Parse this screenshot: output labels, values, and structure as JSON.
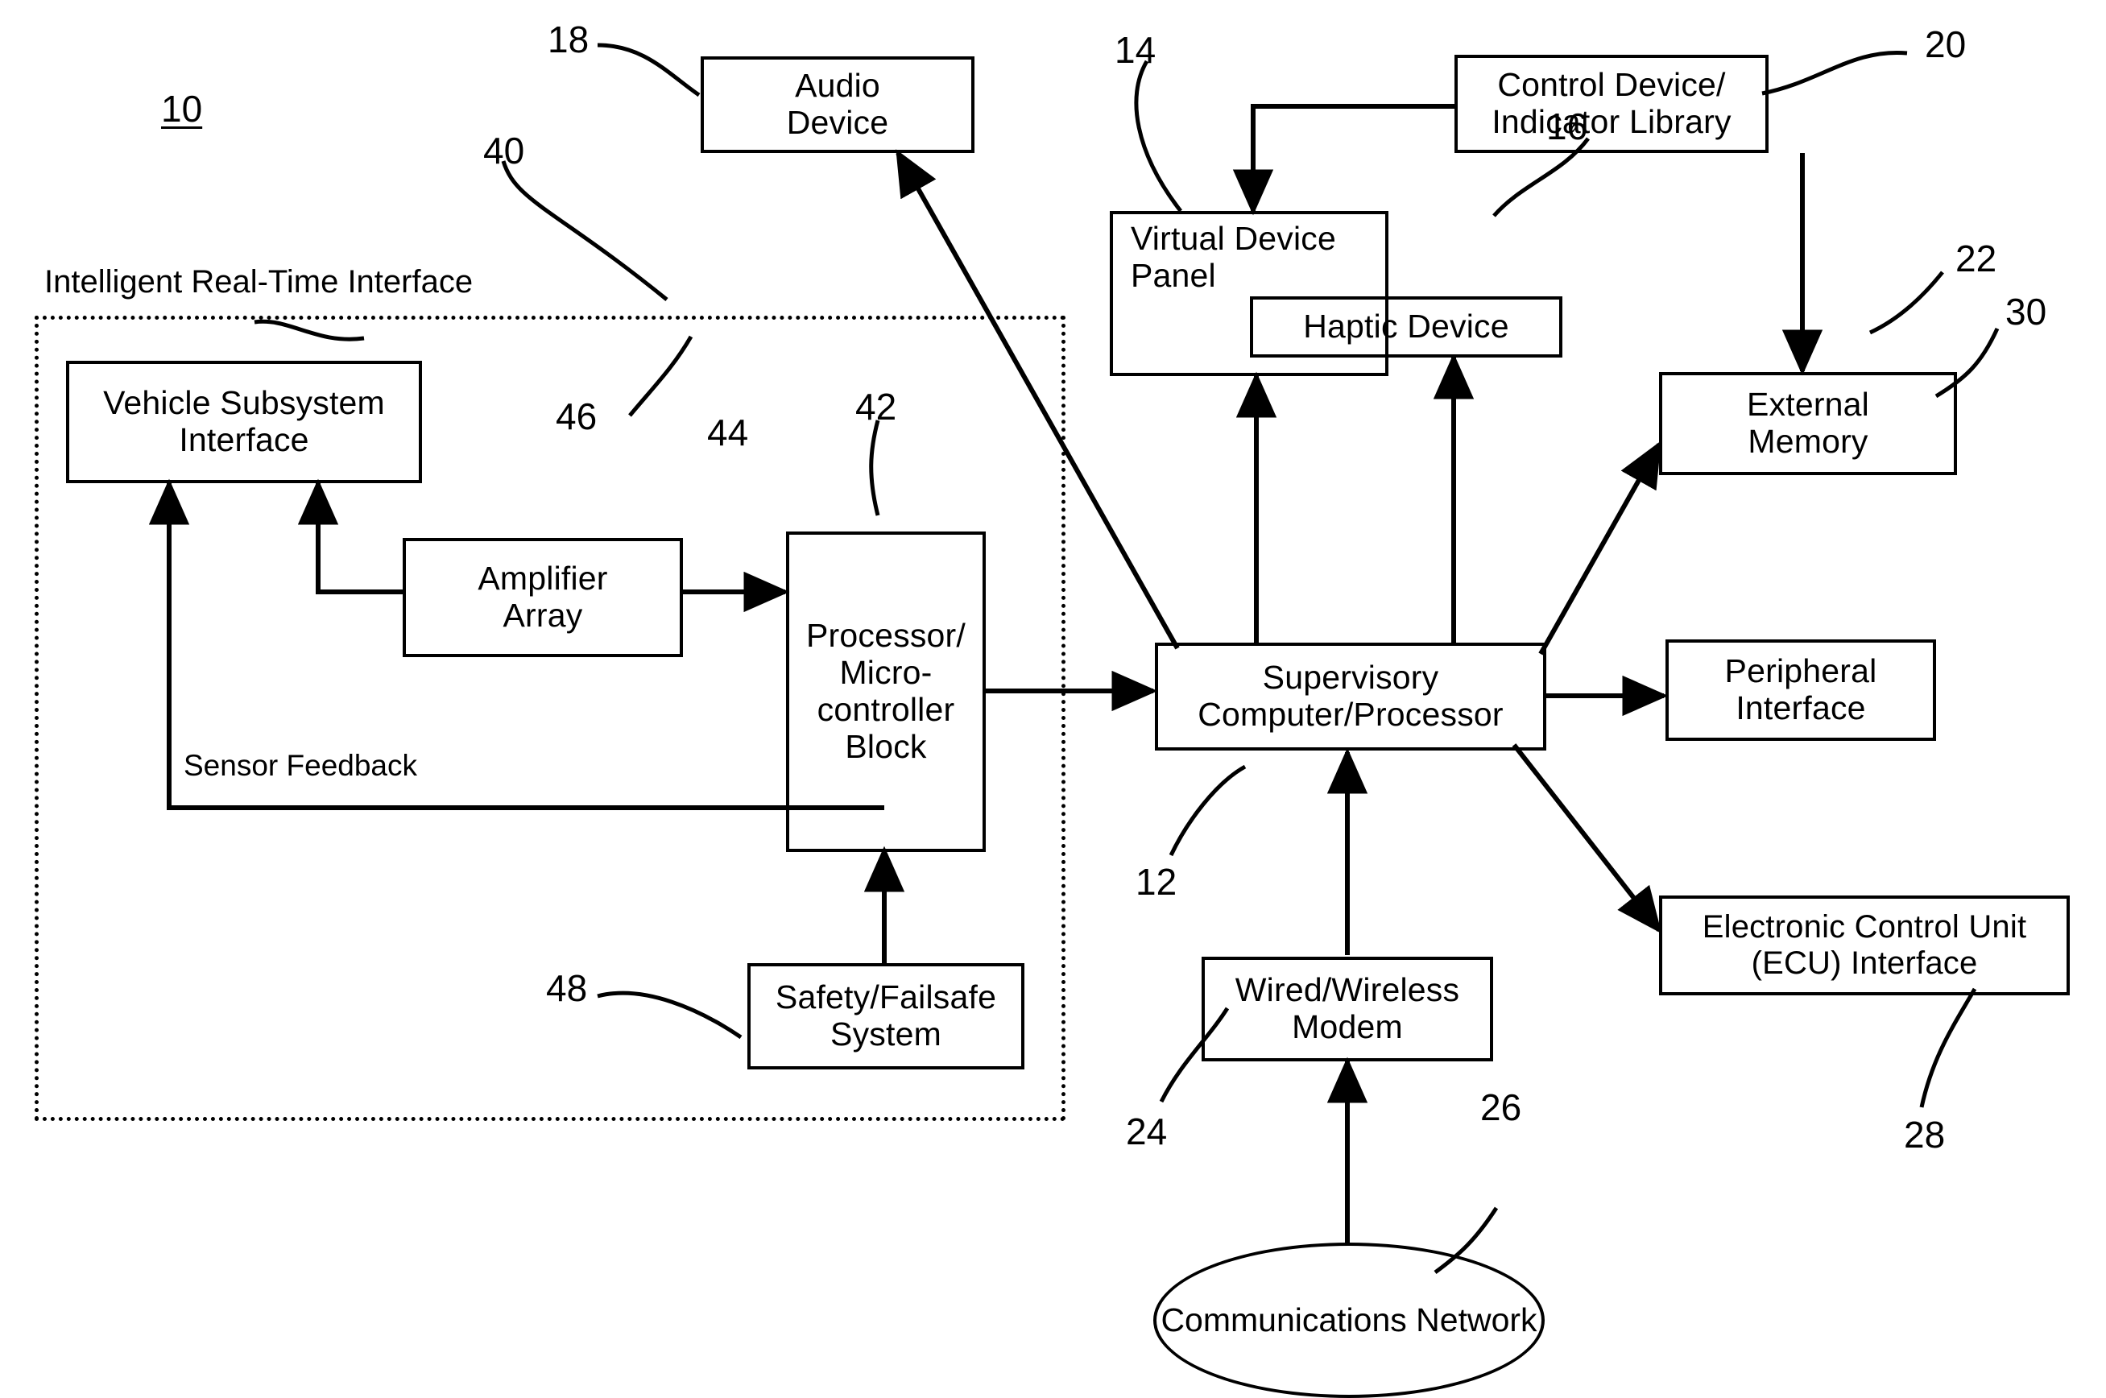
{
  "figure": {
    "figure_ref": "10",
    "region_label": "Intelligent Real-Time Interface",
    "region_ref": "40",
    "inline_label_sensor_feedback": "Sensor Feedback"
  },
  "nodes": {
    "audio_device": {
      "label": "Audio\nDevice",
      "ref": "18"
    },
    "virtual_device_panel": {
      "label": "Virtual Device\nPanel",
      "ref": "14"
    },
    "haptic_device": {
      "label": "Haptic Device",
      "ref": "16"
    },
    "control_device_library": {
      "label": "Control Device/\nIndicator Library",
      "ref": "20"
    },
    "external_memory": {
      "label": "External\nMemory",
      "ref": "22"
    },
    "peripheral_interface": {
      "label": "Peripheral\nInterface",
      "ref": "30"
    },
    "ecu_interface": {
      "label": "Electronic Control Unit\n(ECU) Interface",
      "ref": "28"
    },
    "supervisory_computer": {
      "label": "Supervisory\nComputer/Processor",
      "ref": "12"
    },
    "wired_wireless_modem": {
      "label": "Wired/Wireless\nModem",
      "ref": "24"
    },
    "communications_network": {
      "label": "Communications\nNetwork",
      "ref": "26"
    },
    "vehicle_subsystem_interface": {
      "label": "Vehicle Subsystem\nInterface",
      "ref": "46"
    },
    "amplifier_array": {
      "label": "Amplifier\nArray",
      "ref": "44"
    },
    "processor_microcontroller_block": {
      "label": "Processor/\nMicro-\ncontroller\nBlock",
      "ref": "42"
    },
    "safety_failsafe_system": {
      "label": "Safety/Failsafe\nSystem",
      "ref": "48"
    }
  },
  "style": {
    "stroke_color": "#000000",
    "background_color": "#ffffff"
  }
}
